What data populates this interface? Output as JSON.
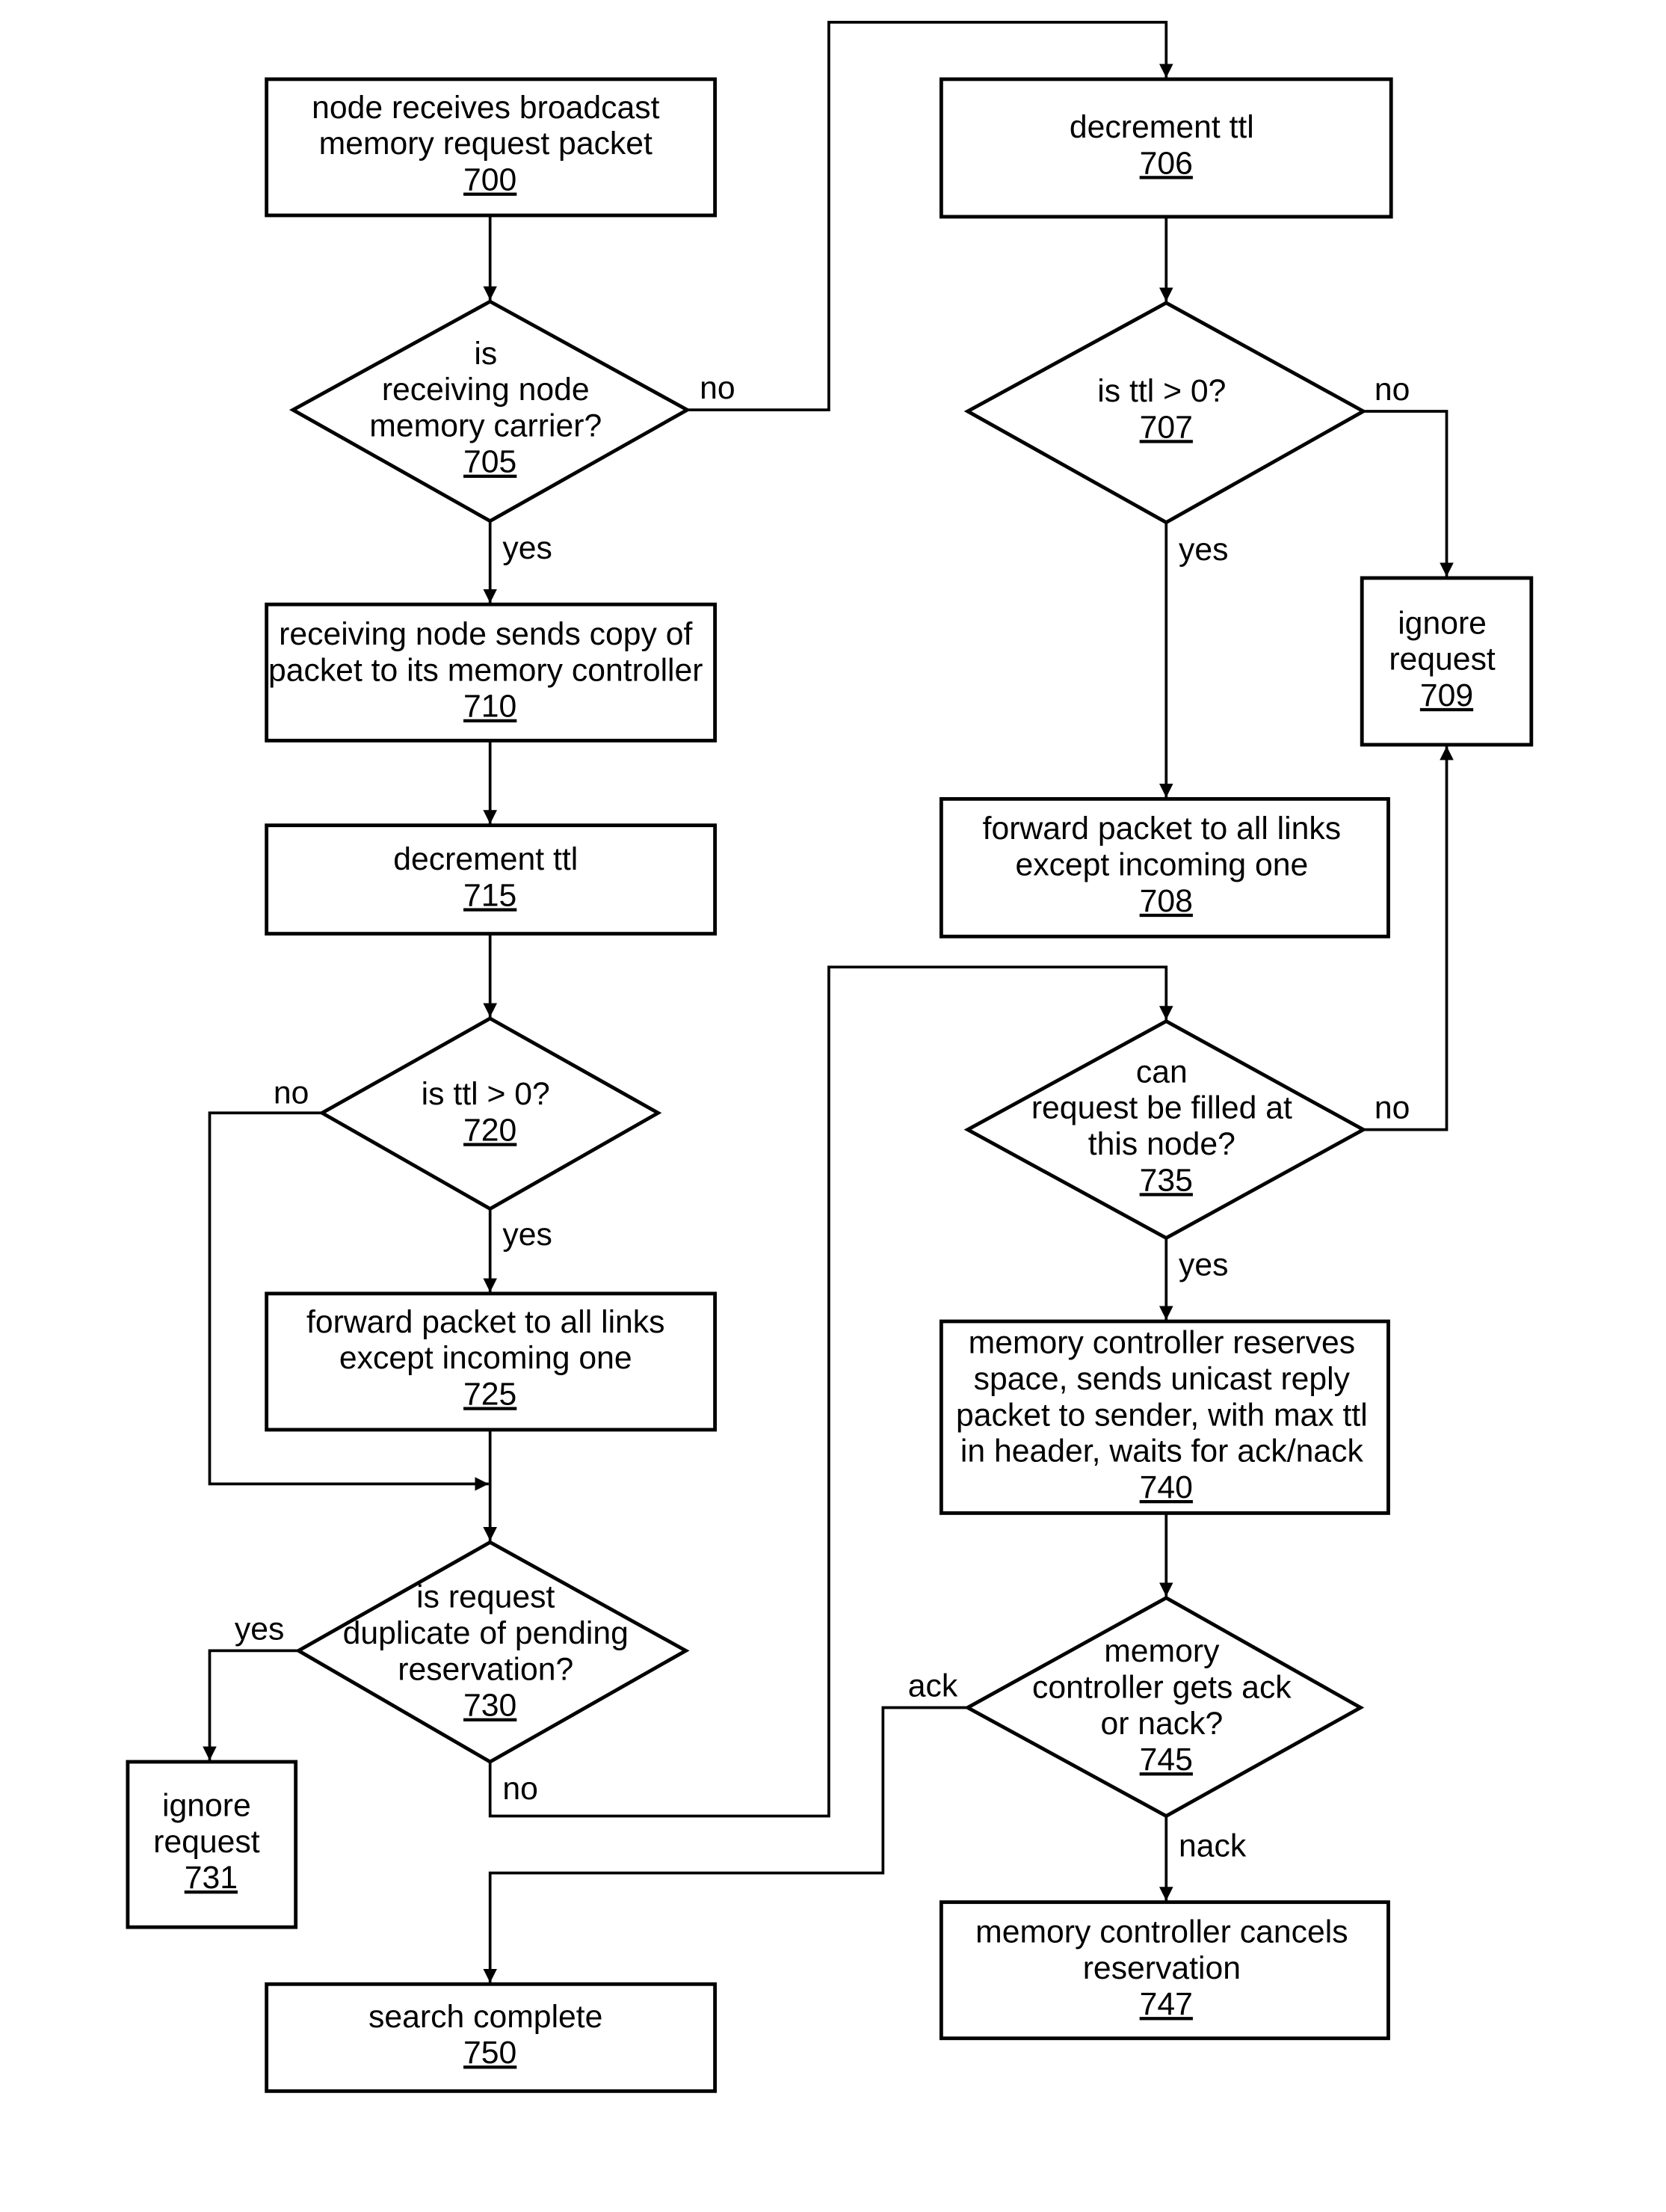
{
  "nodes": {
    "n700": {
      "lines": [
        "node receives broadcast",
        "memory request packet"
      ],
      "ref": "700"
    },
    "n705": {
      "lines": [
        "is",
        "receiving node",
        "memory carrier?"
      ],
      "ref": "705"
    },
    "n706": {
      "lines": [
        "decrement ttl"
      ],
      "ref": "706"
    },
    "n707": {
      "lines": [
        "is ttl > 0?"
      ],
      "ref": "707"
    },
    "n708": {
      "lines": [
        "forward packet to all links",
        "except incoming one"
      ],
      "ref": "708"
    },
    "n709": {
      "lines": [
        "ignore",
        "request"
      ],
      "ref": "709"
    },
    "n710": {
      "lines": [
        "receiving node sends copy of",
        "packet to its memory controller"
      ],
      "ref": "710"
    },
    "n715": {
      "lines": [
        "decrement ttl"
      ],
      "ref": "715"
    },
    "n720": {
      "lines": [
        "is ttl > 0?"
      ],
      "ref": "720"
    },
    "n725": {
      "lines": [
        "forward packet to all links",
        "except incoming one"
      ],
      "ref": "725"
    },
    "n730": {
      "lines": [
        "is request",
        "duplicate of pending",
        "reservation?"
      ],
      "ref": "730"
    },
    "n731": {
      "lines": [
        "ignore",
        "request"
      ],
      "ref": "731"
    },
    "n735": {
      "lines": [
        "can",
        "request be filled at",
        "this node?"
      ],
      "ref": "735"
    },
    "n740": {
      "lines": [
        "memory controller reserves",
        "space, sends unicast reply",
        "packet to sender, with max ttl",
        "in header, waits for ack/nack"
      ],
      "ref": "740"
    },
    "n745": {
      "lines": [
        "memory",
        "controller gets ack",
        "or nack?"
      ],
      "ref": "745"
    },
    "n747": {
      "lines": [
        "memory controller cancels",
        "reservation"
      ],
      "ref": "747"
    },
    "n750": {
      "lines": [
        "search complete"
      ],
      "ref": "750"
    }
  },
  "edge_labels": {
    "e705_no": "no",
    "e705_yes": "yes",
    "e707_no": "no",
    "e707_yes": "yes",
    "e720_no": "no",
    "e720_yes": "yes",
    "e730_yes": "yes",
    "e730_no": "no",
    "e735_no": "no",
    "e735_yes": "yes",
    "e745_ack": "ack",
    "e745_nack": "nack"
  }
}
